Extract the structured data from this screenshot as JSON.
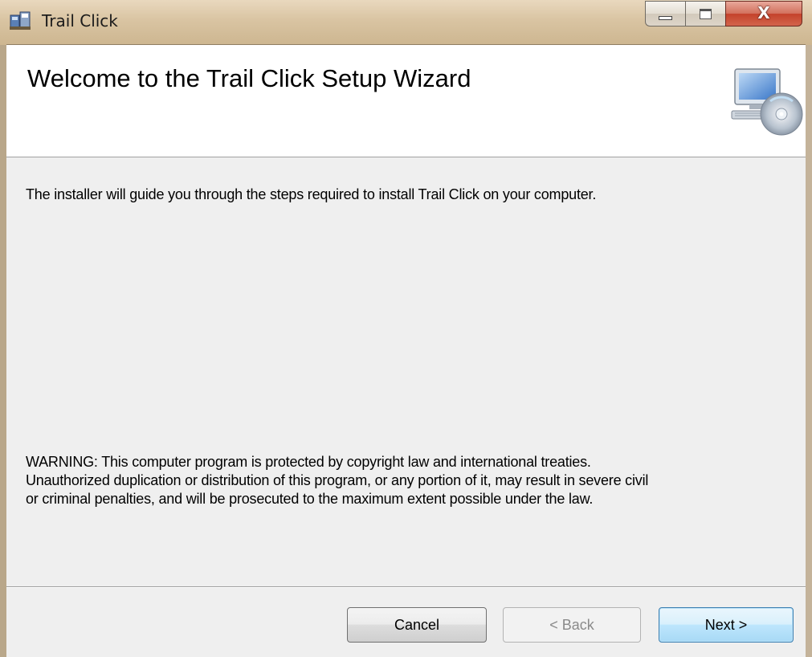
{
  "window": {
    "title": "Trail Click",
    "title_icon": "installer-icon",
    "caption": {
      "minimize_icon": "minimize-icon",
      "maximize_icon": "maximize-icon",
      "close_glyph": "X"
    }
  },
  "banner": {
    "title": "Welcome to the Trail Click Setup Wizard",
    "icon": "computer-cd-icon"
  },
  "body": {
    "intro": "The installer will guide you through the steps required to install Trail Click on your computer.",
    "warning_lines": [
      "WARNING: This computer program is protected by copyright law and international treaties.",
      "Unauthorized duplication or distribution of this program, or any portion of it, may result in severe civil",
      "or criminal penalties, and will be prosecuted to the maximum extent possible under the law."
    ]
  },
  "footer": {
    "cancel_label": "Cancel",
    "back_label": "< Back",
    "next_label": "Next >"
  },
  "colors": {
    "title_bar": "#d9c4a2",
    "close_button": "#c4422b",
    "next_button_border": "#3c7fb1",
    "dialog_background": "#efefef"
  }
}
